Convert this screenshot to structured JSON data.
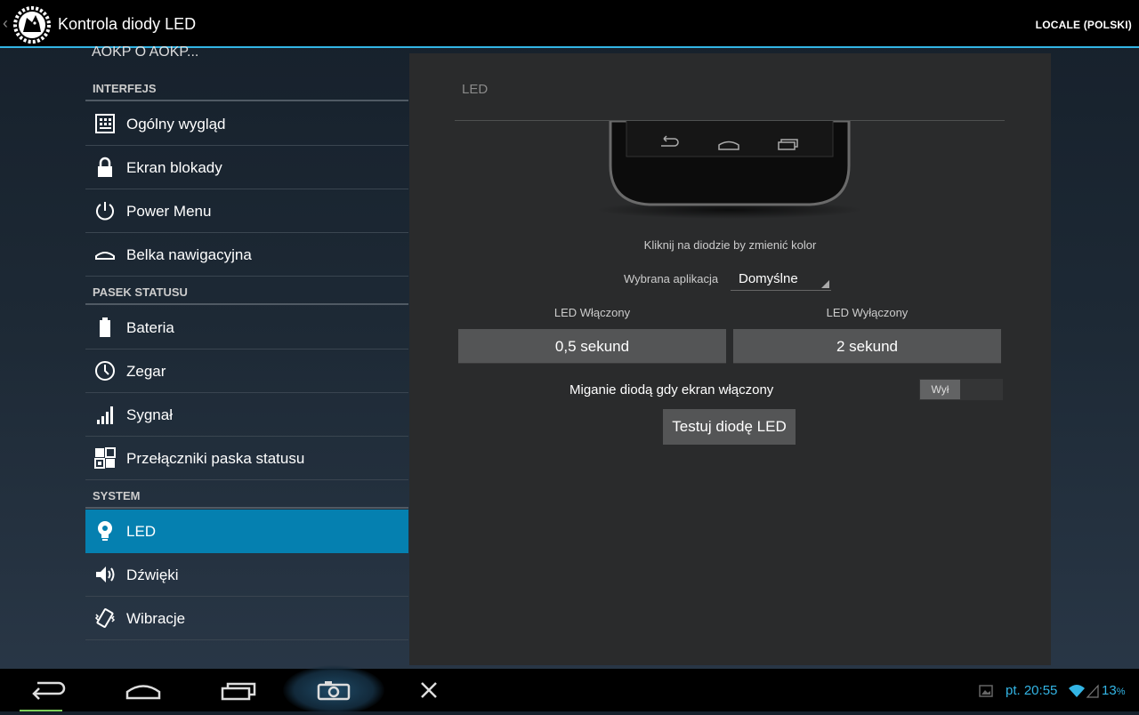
{
  "header": {
    "title": "Kontrola diody LED",
    "action": "LOCALE (POLSKI)",
    "logo_icon": "wolf-gear-logo-icon"
  },
  "sidebar": {
    "partial_item": "AOKP O AOKP...",
    "sections": [
      {
        "header": "INTERFEJS",
        "items": [
          {
            "label": "Ogólny wygląd",
            "icon": "grid-icon"
          },
          {
            "label": "Ekran blokady",
            "icon": "lock-icon"
          },
          {
            "label": "Power Menu",
            "icon": "power-icon"
          },
          {
            "label": "Belka nawigacyjna",
            "icon": "home-bar-icon"
          }
        ]
      },
      {
        "header": "PASEK STATUSU",
        "items": [
          {
            "label": "Bateria",
            "icon": "battery-icon"
          },
          {
            "label": "Zegar",
            "icon": "clock-icon"
          },
          {
            "label": "Sygnał",
            "icon": "signal-icon"
          },
          {
            "label": "Przełączniki paska statusu",
            "icon": "toggles-icon"
          }
        ]
      },
      {
        "header": "SYSTEM",
        "items": [
          {
            "label": "LED",
            "icon": "bulb-icon",
            "active": true
          },
          {
            "label": "Dźwięki",
            "icon": "speaker-icon"
          },
          {
            "label": "Wibracje",
            "icon": "vibrate-icon"
          }
        ]
      }
    ]
  },
  "panel": {
    "title": "LED",
    "hint": "Kliknij na diodzie by zmienić kolor",
    "app_label": "Wybrana aplikacja",
    "app_value": "Domyślne",
    "on_label": "LED Włączony",
    "on_value": "0,5 sekund",
    "off_label": "LED Wyłączony",
    "off_value": "2 sekund",
    "blink_label": "Miganie diodą gdy ekran włączony",
    "blink_toggle": "Wył",
    "test_button": "Testuj diodę LED"
  },
  "status_bar": {
    "time": "pt. 20:55",
    "battery": "13",
    "battery_unit": "%"
  },
  "colors": {
    "accent": "#33b5e5",
    "active_item": "#0580b0",
    "panel": "#2a2b2c"
  }
}
